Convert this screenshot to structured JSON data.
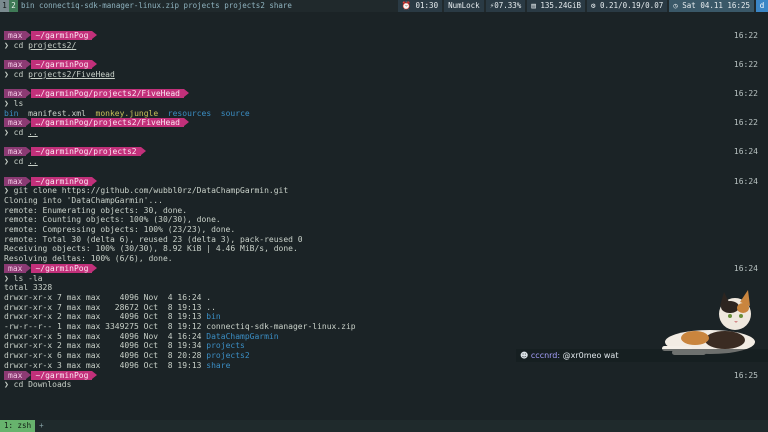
{
  "topbar": {
    "workspaces": [
      "1",
      "2"
    ],
    "pane_label": "bin  connectiq-sdk-manager-linux.zip  projects  projects2  share",
    "status": {
      "time": "01:30",
      "numlock": "NumLock",
      "battery": "07.33%",
      "disk": "135.24GiB",
      "load": "0.21/0.19/0.07",
      "date": "Sat 04.11 16:25",
      "app": "d"
    }
  },
  "prompt": {
    "user": "max",
    "tilde": "~/"
  },
  "terminal": [
    {
      "type": "prompt",
      "path": "~/garminPog",
      "time": "16:22"
    },
    {
      "type": "cmd",
      "text": "cd ",
      "arg": "projects2/"
    },
    {
      "type": "prompt",
      "path": "~/garminPog",
      "time": "16:22"
    },
    {
      "type": "cmd",
      "text": "cd ",
      "arg": "projects2/FiveHead"
    },
    {
      "type": "prompt",
      "path": "…/garminPog/projects2/FiveHead",
      "time": "16:22"
    },
    {
      "type": "cmd",
      "text": "ls",
      "arg": ""
    },
    {
      "type": "ls",
      "items": [
        {
          "t": "bin",
          "c": "dir"
        },
        {
          "t": "manifest.xml",
          "c": "file"
        },
        {
          "t": "monkey.jungle",
          "c": "exe"
        },
        {
          "t": "resources",
          "c": "dir"
        },
        {
          "t": "source",
          "c": "dir"
        }
      ]
    },
    {
      "type": "prompt",
      "path": "…/garminPog/projects2/FiveHead",
      "time": "16:22"
    },
    {
      "type": "cmd",
      "text": "cd ",
      "arg": ".."
    },
    {
      "type": "prompt",
      "path": "~/garminPog/projects2",
      "time": "16:24"
    },
    {
      "type": "cmd",
      "text": "cd ",
      "arg": ".."
    },
    {
      "type": "prompt",
      "path": "~/garminPog",
      "time": "16:24"
    },
    {
      "type": "cmd",
      "text": "git clone https://github.com/wubbl0rz/DataChampGarmin.git",
      "arg": ""
    },
    {
      "type": "out",
      "text": "Cloning into 'DataChampGarmin'..."
    },
    {
      "type": "out",
      "text": "remote: Enumerating objects: 30, done."
    },
    {
      "type": "out",
      "text": "remote: Counting objects: 100% (30/30), done."
    },
    {
      "type": "out",
      "text": "remote: Compressing objects: 100% (23/23), done."
    },
    {
      "type": "out",
      "text": "remote: Total 30 (delta 6), reused 23 (delta 3), pack-reused 0"
    },
    {
      "type": "out",
      "text": "Receiving objects: 100% (30/30), 8.92 KiB | 4.46 MiB/s, done."
    },
    {
      "type": "out",
      "text": "Resolving deltas: 100% (6/6), done."
    },
    {
      "type": "prompt",
      "path": "~/garminPog",
      "time": "16:24"
    },
    {
      "type": "cmd",
      "text": "ls -la",
      "arg": ""
    },
    {
      "type": "out",
      "text": "total 3328"
    },
    {
      "type": "lsl",
      "pre": "drwxr-xr-x 7 max max    4096 Nov  4 16:24 ",
      "name": ".",
      "c": "file"
    },
    {
      "type": "lsl",
      "pre": "drwxr-xr-x 7 max max   28672 Oct  8 19:13 ",
      "name": "..",
      "c": "file"
    },
    {
      "type": "lsl",
      "pre": "drwxr-xr-x 2 max max    4096 Oct  8 19:13 ",
      "name": "bin",
      "c": "dir"
    },
    {
      "type": "lsl",
      "pre": "-rw-r--r-- 1 max max 3349275 Oct  8 19:12 ",
      "name": "connectiq-sdk-manager-linux.zip",
      "c": "file"
    },
    {
      "type": "lsl",
      "pre": "drwxr-xr-x 5 max max    4096 Nov  4 16:24 ",
      "name": "DataChampGarmin",
      "c": "dir"
    },
    {
      "type": "lsl",
      "pre": "drwxr-xr-x 2 max max    4096 Oct  8 19:34 ",
      "name": "projects",
      "c": "dir"
    },
    {
      "type": "lsl",
      "pre": "drwxr-xr-x 6 max max    4096 Oct  8 20:28 ",
      "name": "projects2",
      "c": "dir"
    },
    {
      "type": "lsl",
      "pre": "drwxr-xr-x 3 max max    4096 Oct  8 19:13 ",
      "name": "share",
      "c": "dir"
    },
    {
      "type": "prompt",
      "path": "~/garminPog",
      "time": "16:25"
    },
    {
      "type": "cmd",
      "text": "cd Downloads",
      "arg": ""
    }
  ],
  "chat": {
    "name": "cccnrd:",
    "message": "@xr0meo wat"
  },
  "bottombar": {
    "window": "1: zsh",
    "plus": "+"
  },
  "colors": {
    "prompt_user": "#8b3a73",
    "prompt_path": "#c2307a",
    "dir": "#3b8ec4",
    "exe": "#c7c05a"
  }
}
